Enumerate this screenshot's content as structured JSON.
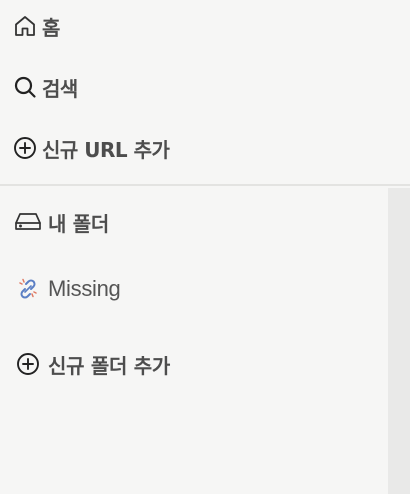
{
  "nav": {
    "home_label": "홈",
    "search_label": "검색",
    "add_url_label": "신규 URL 추가"
  },
  "folders": {
    "my_folder_label": "내 폴더",
    "missing_label": "Missing",
    "add_folder_label": "신규 폴더 추가"
  },
  "icons": {
    "home": "home-icon",
    "search": "search-icon",
    "add_url": "plus-circle-icon",
    "my_folder": "drive-icon",
    "missing": "broken-link-icon",
    "add_folder": "plus-circle-icon"
  },
  "colors": {
    "background": "#f6f6f5",
    "text": "#4d4d4d",
    "divider": "#e3e3e1",
    "scrollbar": "#e9e9e8",
    "link_icon_primary": "#5b7fc4",
    "link_icon_secondary": "#e07a63"
  }
}
